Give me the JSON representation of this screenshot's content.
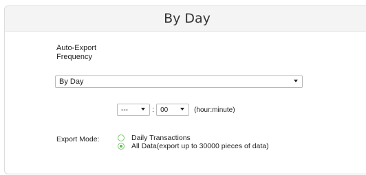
{
  "header": {
    "title": "By Day"
  },
  "frequency": {
    "label": "Auto-Export Frequency",
    "selected": "By Day"
  },
  "time": {
    "hour": "---",
    "separator": ":",
    "minute": "00",
    "unit_hint": "(hour:minute)"
  },
  "export_mode": {
    "label": "Export Mode:",
    "options": [
      {
        "label": "Daily Transactions",
        "checked": false
      },
      {
        "label": "All Data(export up to 30000 pieces of data)",
        "checked": true
      }
    ]
  },
  "colors": {
    "radio_accent": "#5fba55",
    "header_bg": "#f4f4f4"
  }
}
